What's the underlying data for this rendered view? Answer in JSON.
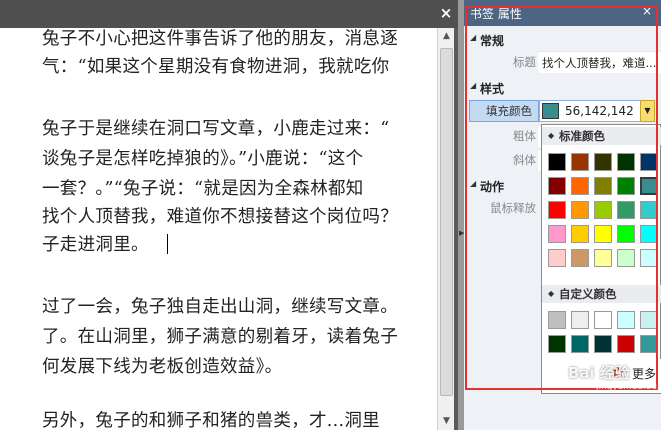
{
  "document": {
    "lines": [
      "兔子不小心把这件事告诉了他的朋友，消息逐",
      "气：“如果这个星期没有食物进洞，我就吃你",
      "兔子于是继续在洞口写文章，小鹿走过来：“",
      "谈兔子是怎样吃掉狼的》。”小鹿说：“这个",
      "一套？。”“兔子说：“就是因为全森林都知",
      "找个人顶替我，难道你不想接替这个岗位吗？",
      "子走进洞里。",
      "过了一会，兔子独自走出山洞，继续写文章。",
      "了。在山洞里，狮子满意的剔着牙，读着兔子",
      "何发展下线为老板创造效益》。",
      "另外，兔子的和狮子和猪的兽类，才...洞里"
    ],
    "close_icon": "×"
  },
  "panel": {
    "title": "书签 属性",
    "close_icon": "×",
    "sections": {
      "general": "常规",
      "style": "样式",
      "action": "动作"
    },
    "props": {
      "title_label": "标题",
      "title_value": "找个人顶替我，难道...",
      "fill_label": "填充颜色",
      "fill_value": "56,142,142",
      "fill_color": "#388e8e",
      "bold_label": "粗体",
      "italic_label": "斜体",
      "mouse_label": "鼠标释放"
    }
  },
  "popup": {
    "standard_label": "标准颜色",
    "custom_label": "自定义颜色",
    "more_label": "更多",
    "standard_colors": [
      [
        "#000000",
        "#993300",
        "#333300",
        "#003300",
        "#003366"
      ],
      [
        "#800000",
        "#ff6600",
        "#808000",
        "#008000",
        "#388e8e"
      ],
      [
        "#ff0000",
        "#ff9900",
        "#99cc00",
        "#339966",
        "#33cccc"
      ],
      [
        "#ff99cc",
        "#ffcc00",
        "#ffff00",
        "#00ff00",
        "#00ffff"
      ],
      [
        "#ffcccc",
        "#cc9966",
        "#ffff99",
        "#ccffcc",
        "#ccffff"
      ]
    ],
    "custom_colors": [
      [
        "#c0c0c0",
        "#eeeeee",
        "#ffffff",
        "#ccffff",
        "#c7f0f0"
      ],
      [
        "#003300",
        "#006666",
        "#003333",
        "#cc0000",
        "#339999"
      ]
    ]
  },
  "watermark": {
    "text": "Bai 经验",
    "sub": "jingyan.baidu.com"
  }
}
